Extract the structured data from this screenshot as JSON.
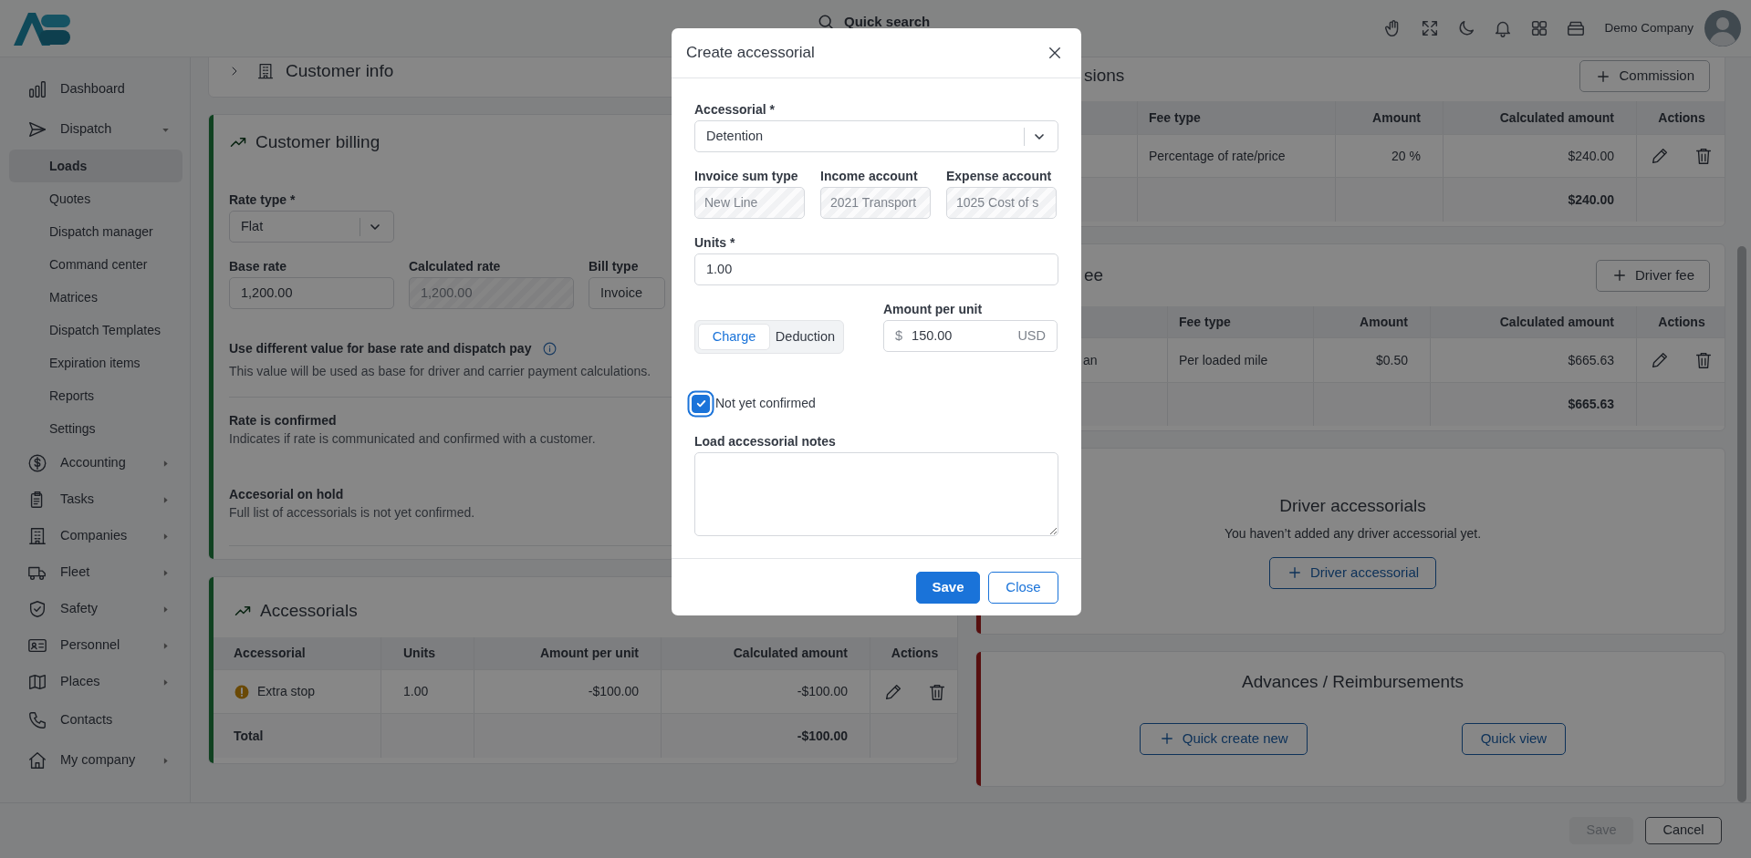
{
  "topbar": {
    "search": "Quick search",
    "company": "Demo Company"
  },
  "sidebar": {
    "items": [
      {
        "label": "Dashboard",
        "selected": false
      },
      {
        "label": "Dispatch",
        "selected": false,
        "expanded": true,
        "children": [
          {
            "label": "Loads",
            "selected": true
          },
          {
            "label": "Quotes",
            "selected": false
          },
          {
            "label": "Dispatch manager",
            "selected": false
          },
          {
            "label": "Command center",
            "selected": false
          },
          {
            "label": "Matrices",
            "selected": false
          },
          {
            "label": "Dispatch Templates",
            "selected": false
          },
          {
            "label": "Expiration items",
            "selected": false
          },
          {
            "label": "Reports",
            "selected": false
          },
          {
            "label": "Settings",
            "selected": false
          }
        ]
      },
      {
        "label": "Accounting",
        "selected": false,
        "expanded": false
      },
      {
        "label": "Tasks",
        "selected": false,
        "expanded": false
      },
      {
        "label": "Companies",
        "selected": false,
        "expanded": false
      },
      {
        "label": "Fleet",
        "selected": false,
        "expanded": false
      },
      {
        "label": "Safety",
        "selected": false,
        "expanded": false
      },
      {
        "label": "Personnel",
        "selected": false,
        "expanded": false
      },
      {
        "label": "Places",
        "selected": false,
        "expanded": false
      },
      {
        "label": "Contacts",
        "selected": false
      },
      {
        "label": "My company",
        "selected": false,
        "expanded": false
      }
    ]
  },
  "left_column": {
    "customer_info": {
      "title": "Customer info",
      "expanded": false
    },
    "customer_billing": {
      "title": "Customer billing",
      "color": "#104120",
      "rate_type": {
        "label": "Rate type *",
        "value": "Flat"
      },
      "fields": [
        {
          "label": "Base rate",
          "value": "1,200.00",
          "disabled": false
        },
        {
          "label": "Calculated rate",
          "value": "1,200.00",
          "disabled": true
        },
        {
          "label": "Bill type",
          "value": "Invoice",
          "disabled": false
        }
      ],
      "settings": [
        {
          "title": "Use different value for base rate and dispatch pay",
          "description": "This value will be used as base for driver and carrier payment calculations.",
          "info": true
        },
        {
          "title": "Rate is confirmed",
          "description": "Indicates if rate is communicated and confirmed with a customer.",
          "info": false
        },
        {
          "title": "Accesorial on hold",
          "description": "Full list of accessorials is not yet confirmed.",
          "info": false
        }
      ]
    },
    "accessorials": {
      "title": "Accessorials",
      "color": "#104120",
      "columns": [
        "Accessorial",
        "Units",
        "Amount per unit",
        "Calculated amount",
        "Actions"
      ],
      "rows": [
        {
          "accessorial": "Extra stop",
          "warning": true,
          "units": "1.00",
          "amount_per_unit": "-$100.00",
          "calculated_amount": "-$100.00"
        }
      ],
      "total": {
        "label": "Total",
        "calculated_amount": "-$100.00"
      }
    }
  },
  "right_column": {
    "commissions": {
      "title": "sions",
      "button": "Commission",
      "columns": [
        "Fee type",
        "Amount",
        "Calculated amount",
        "Actions"
      ],
      "rows": [
        {
          "fee_type": "Percentage of rate/price",
          "amount": "20 %",
          "calculated_amount": "$240.00"
        }
      ],
      "total": {
        "calculated_amount": "$240.00"
      }
    },
    "driver_fee": {
      "title": "ee",
      "button": "Driver fee",
      "columns": [
        "Fee type",
        "Amount",
        "Calculated amount",
        "Actions"
      ],
      "rows": [
        {
          "column_1": "an",
          "fee_type": "Per loaded mile",
          "amount": "$0.50",
          "calculated_amount": "$665.63"
        }
      ],
      "total": {
        "calculated_amount": "$665.63"
      }
    },
    "driver_accessorials": {
      "title": "Driver accessorials",
      "message": "You haven’t added any driver accessorial yet.",
      "button": "Driver accessorial",
      "color": "#570f0f"
    },
    "advances": {
      "title": "Advances / Reimbursements",
      "color": "#570f0f",
      "buttons": [
        {
          "label": "Quick create new",
          "kind": "add"
        },
        {
          "label": "Quick view",
          "kind": "plain"
        }
      ]
    }
  },
  "footer": {
    "buttons": [
      {
        "label": "Save",
        "disabled": true
      },
      {
        "label": "Cancel",
        "disabled": false
      }
    ]
  },
  "modal": {
    "title": "Create accessorial",
    "accessorial": {
      "label": "Accessorial *",
      "value": "Detention"
    },
    "accounts": [
      {
        "label": "Invoice sum type",
        "value": "New Line",
        "disabled": true
      },
      {
        "label": "Income account",
        "value": "2021 Transport",
        "disabled": true
      },
      {
        "label": "Expense account",
        "value": "1025 Cost of s",
        "disabled": true
      }
    ],
    "units": {
      "label": "Units *",
      "value": "1.00"
    },
    "type_options": [
      {
        "label": "Charge",
        "selected": true
      },
      {
        "label": "Deduction",
        "selected": false
      }
    ],
    "amount": {
      "label": "Amount per unit",
      "prefix": "$",
      "value": "150.00",
      "suffix": "USD"
    },
    "checkbox": {
      "label": "Not yet confirmed",
      "checked": true
    },
    "notes": {
      "label": "Load accessorial notes"
    },
    "buttons": [
      {
        "label": "Save",
        "kind": "primary"
      },
      {
        "label": "Close",
        "kind": "outline"
      }
    ]
  }
}
